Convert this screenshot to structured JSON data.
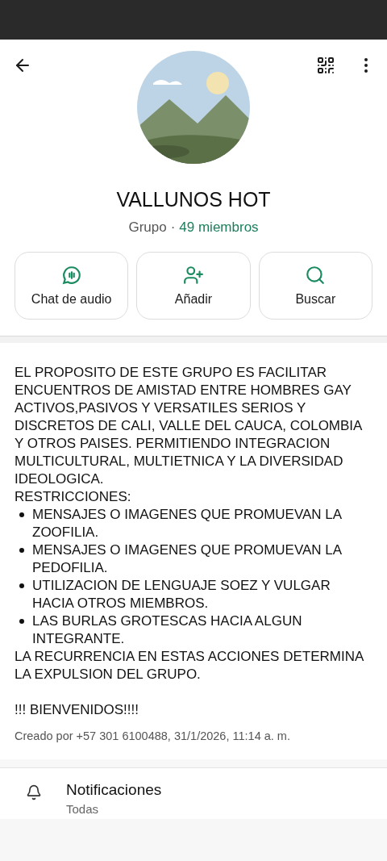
{
  "group": {
    "name": "VALLUNOS HOT",
    "type": "Grupo",
    "separator": "·",
    "members": "49 miembros"
  },
  "actions": [
    {
      "kind": "audio",
      "label": "Chat de audio"
    },
    {
      "kind": "add",
      "label": "Añadir"
    },
    {
      "kind": "search",
      "label": "Buscar"
    }
  ],
  "description": {
    "intro": "EL PROPOSITO DE ESTE GRUPO ES FACILITAR ENCUENTROS DE AMISTAD ENTRE HOMBRES GAY ACTIVOS,PASIVOS Y VERSATILES SERIOS Y DISCRETOS DE CALI, VALLE DEL CAUCA, COLOMBIA Y OTROS PAISES. PERMITIENDO INTEGRACION MULTICULTURAL, MULTIETNICA Y LA DIVERSIDAD IDEOLOGICA.",
    "heading": "RESTRICCIONES:",
    "rules": [
      "MENSAJES O IMAGENES QUE PROMUEVAN LA ZOOFILIA.",
      "MENSAJES O IMAGENES QUE PROMUEVAN LA PEDOFILIA.",
      "UTILIZACION DE LENGUAJE SOEZ Y VULGAR HACIA OTROS MIEMBROS.",
      "LAS BURLAS GROTESCAS HACIA ALGUN INTEGRANTE."
    ],
    "closing": "LA RECURRENCIA EN ESTAS ACCIONES DETERMINA LA EXPULSION DEL GRUPO.",
    "welcome": "!!! BIENVENIDOS!!!!",
    "created": "Creado por +57 301 6100488, 31/1/2026, 11:14 a. m."
  },
  "settings": [
    {
      "kind": "notifications",
      "title": "Notificaciones",
      "value": "Todas"
    }
  ]
}
